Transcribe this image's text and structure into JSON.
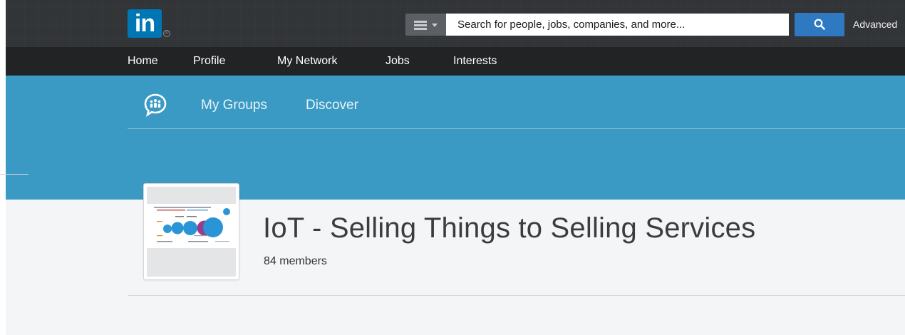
{
  "header": {
    "logo_text": "in",
    "logo_reg": "®",
    "search": {
      "placeholder": "Search for people, jobs, companies, and more..."
    },
    "advanced_label": "Advanced"
  },
  "nav": {
    "items": [
      {
        "label": "Home"
      },
      {
        "label": "Profile"
      },
      {
        "label": "My Network"
      },
      {
        "label": "Jobs"
      },
      {
        "label": "Interests"
      }
    ]
  },
  "groups_nav": {
    "icon": "groups-chat-icon",
    "items": [
      {
        "label": "My Groups"
      },
      {
        "label": "Discover"
      }
    ]
  },
  "group": {
    "title": "IoT - Selling Things to Selling Services",
    "members": "84 members"
  },
  "colors": {
    "topbar": "#303336",
    "navbar": "#212325",
    "banner": "#3a9ac4",
    "brand": "#0077b5",
    "search_button": "#2e79c2"
  }
}
